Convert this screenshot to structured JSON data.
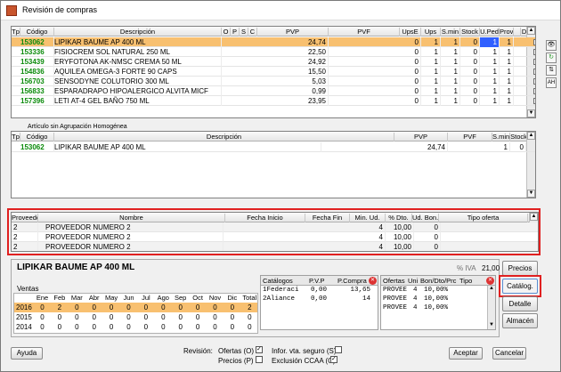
{
  "window": {
    "title": "Revisión de compras"
  },
  "top_grid": {
    "columns": [
      "Tp",
      "Código",
      "Descripción",
      "O",
      "P",
      "S",
      "C",
      "PVP",
      "PVF",
      "UpsE",
      "Ups",
      "S.min",
      "Stock",
      "U.Ped",
      "Prov",
      "",
      "Del",
      "",
      "B"
    ],
    "rows": [
      {
        "code": "153062",
        "desc": "LIPIKAR BAUME AP 400 ML",
        "pvp": "24,74",
        "upse": "0",
        "ups": "1",
        "smin": "1",
        "stock": "0",
        "uped": "1",
        "prov": "1",
        "sel": true
      },
      {
        "code": "153336",
        "desc": "FISIOCREM SOL NATURAL 250 ML",
        "pvp": "22,50",
        "upse": "0",
        "ups": "1",
        "smin": "1",
        "stock": "0",
        "uped": "1",
        "prov": "1"
      },
      {
        "code": "153439",
        "desc": "ERYFOTONA AK-NMSC CREMA 50 ML",
        "pvp": "24,92",
        "upse": "0",
        "ups": "1",
        "smin": "1",
        "stock": "0",
        "uped": "1",
        "prov": "1"
      },
      {
        "code": "154836",
        "desc": "AQUILEA OMEGA-3 FORTE  90 CAPS",
        "pvp": "15,50",
        "upse": "0",
        "ups": "1",
        "smin": "1",
        "stock": "0",
        "uped": "1",
        "prov": "1"
      },
      {
        "code": "156703",
        "desc": "SENSODYNE COLUTORIO 300 ML",
        "pvp": "5,03",
        "upse": "0",
        "ups": "1",
        "smin": "1",
        "stock": "0",
        "uped": "1",
        "prov": "1"
      },
      {
        "code": "156833",
        "desc": "ESPARADRAPO HIPOALERGICO ALVITA MICF",
        "pvp": "0,99",
        "upse": "0",
        "ups": "1",
        "smin": "1",
        "stock": "0",
        "uped": "1",
        "prov": "1"
      },
      {
        "code": "157396",
        "desc": "LETI AT-4 GEL BAÑO 750 ML",
        "pvp": "23,95",
        "upse": "0",
        "ups": "1",
        "smin": "1",
        "stock": "0",
        "uped": "1",
        "prov": "1"
      }
    ]
  },
  "mid_grid": {
    "caption": "Artículo sin Agrupación Homogénea",
    "columns": [
      "Tp",
      "Código",
      "Descripción",
      "PVP",
      "PVF",
      "S.min",
      "Stock"
    ],
    "rows": [
      {
        "code": "153062",
        "desc": "LIPIKAR BAUME AP 400 ML",
        "pvp": "24,74",
        "smin": "1",
        "stock": "0"
      }
    ]
  },
  "prov_grid": {
    "columns": [
      "Proveedor",
      "Nombre",
      "Fecha Inicio",
      "Fecha Fin",
      "Min. Ud.",
      "% Dto.",
      "Ud. Bon.",
      "Tipo oferta"
    ],
    "rows": [
      {
        "prov": "2",
        "nombre": "PROVEEDOR NUMERO 2",
        "min": "4",
        "dto": "10,00",
        "bon": "0"
      },
      {
        "prov": "2",
        "nombre": "PROVEEDOR NUMERO 2",
        "min": "4",
        "dto": "10,00",
        "bon": "0"
      },
      {
        "prov": "2",
        "nombre": "PROVEEDOR NUMERO 2",
        "min": "4",
        "dto": "10,00",
        "bon": "0"
      }
    ]
  },
  "detail": {
    "product": "LIPIKAR BAUME AP 400 ML",
    "iva_label": "% IVA",
    "iva_value": "21,00",
    "ventas_label": "Ventas",
    "months": [
      "Ene",
      "Feb",
      "Mar",
      "Abr",
      "May",
      "Jun",
      "Jul",
      "Ago",
      "Sep",
      "Oct",
      "Nov",
      "Dic",
      "Total"
    ],
    "years": [
      {
        "year": "2016",
        "vals": [
          "0",
          "2",
          "0",
          "0",
          "0",
          "0",
          "0",
          "0",
          "0",
          "0",
          "0",
          "0",
          "2"
        ]
      },
      {
        "year": "2015",
        "vals": [
          "0",
          "0",
          "0",
          "0",
          "0",
          "0",
          "0",
          "0",
          "0",
          "0",
          "0",
          "0",
          "0"
        ]
      },
      {
        "year": "2014",
        "vals": [
          "0",
          "0",
          "0",
          "0",
          "0",
          "0",
          "0",
          "0",
          "0",
          "0",
          "0",
          "0",
          "0"
        ]
      }
    ]
  },
  "catalogos": {
    "columns": [
      "Catálogos",
      "P.V.P",
      "P.Compra"
    ],
    "rows": [
      {
        "name": "1Federaci",
        "pvp": "0,00",
        "compra": "13,65"
      },
      {
        "name": "2Aliance",
        "pvp": "0,00",
        "compra": "14"
      }
    ]
  },
  "ofertas": {
    "columns": [
      "Ofertas",
      "Uni",
      "Bon/Dto/Prc",
      "Tipo"
    ],
    "rows": [
      {
        "name": "PROVEE",
        "uni": "4",
        "val": "10,00%"
      },
      {
        "name": "PROVEE",
        "uni": "4",
        "val": "10,00%"
      },
      {
        "name": "PROVEE",
        "uni": "4",
        "val": "10,00%"
      }
    ]
  },
  "side_buttons": {
    "precios": "Precios",
    "catalog": "Catálog.",
    "detalle": "Detalle",
    "almacen": "Almacén"
  },
  "footer": {
    "ayuda": "Ayuda",
    "revision": "Revisión:",
    "ofertas": "Ofertas (O)",
    "precios": "Precios (P)",
    "infor": "Infor. vta. seguro (S)",
    "exclusion": "Exclusión CCAA (C)",
    "aceptar": "Aceptar",
    "cancelar": "Cancelar"
  },
  "colors": {
    "selected_row": "#f8c070",
    "code_green": "#0a8a0a",
    "highlight_red": "#e02020",
    "uped_blue": "#3060ff"
  }
}
